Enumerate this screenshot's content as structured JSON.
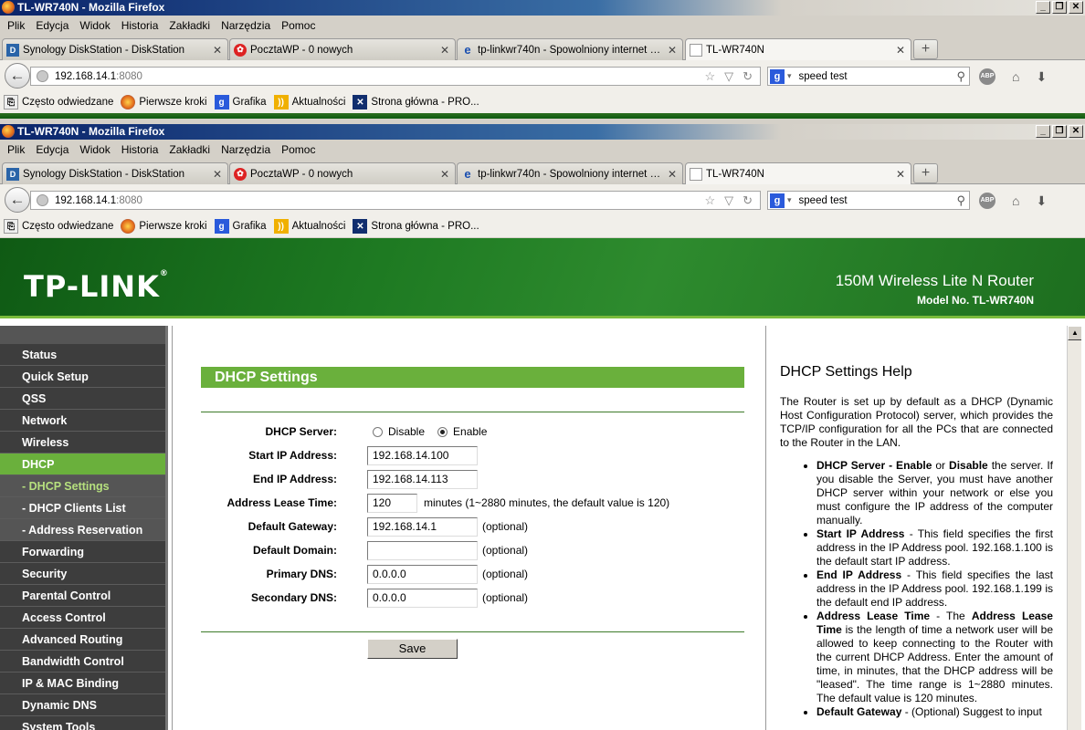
{
  "colors": {
    "brand_green": "#6ab03c",
    "banner_dark": "#0f5a14",
    "sidebar_bg": "#3d3d3d"
  },
  "window1": {
    "title": "TL-WR740N - Mozilla Firefox",
    "menu": [
      "Plik",
      "Edycja",
      "Widok",
      "Historia",
      "Zakładki",
      "Narzędzia",
      "Pomoc"
    ],
    "tabs": [
      {
        "icon": "diskstation-icon",
        "label": "Synology DiskStation - DiskStation"
      },
      {
        "icon": "poczta-icon",
        "label": "PocztaWP - 0 nowych"
      },
      {
        "icon": "ie-icon",
        "label": "tp-linkwr740n - Spowolniony internet od ..."
      },
      {
        "icon": "blank-page-icon",
        "label": "TL-WR740N"
      }
    ],
    "url_host": "192.168.14.1",
    "url_port": ":8080",
    "search_value": "speed test",
    "bookmarks": [
      "Często odwiedzane",
      "Pierwsze kroki",
      "Grafika",
      "Aktualności",
      "Strona główna - PRO..."
    ]
  },
  "window2": {
    "title": "TL-WR740N - Mozilla Firefox",
    "menu": [
      "Plik",
      "Edycja",
      "Widok",
      "Historia",
      "Zakładki",
      "Narzędzia",
      "Pomoc"
    ],
    "tabs": [
      {
        "icon": "diskstation-icon",
        "label": "Synology DiskStation - DiskStation"
      },
      {
        "icon": "poczta-icon",
        "label": "PocztaWP - 0 nowych"
      },
      {
        "icon": "ie-icon",
        "label": "tp-linkwr740n - Spowolniony internet od ..."
      },
      {
        "icon": "blank-page-icon",
        "label": "TL-WR740N"
      }
    ],
    "url_host": "192.168.14.1",
    "url_port": ":8080",
    "search_value": "speed test",
    "bookmarks": [
      "Często odwiedzane",
      "Pierwsze kroki",
      "Grafika",
      "Aktualności",
      "Strona główna - PRO..."
    ]
  },
  "router": {
    "logo": "TP-LINK",
    "product": "150M Wireless Lite N Router",
    "model": "Model No. TL-WR740N",
    "menu": [
      {
        "label": "Status",
        "type": "item"
      },
      {
        "label": "Quick Setup",
        "type": "item"
      },
      {
        "label": "QSS",
        "type": "item"
      },
      {
        "label": "Network",
        "type": "item"
      },
      {
        "label": "Wireless",
        "type": "item"
      },
      {
        "label": "DHCP",
        "type": "item",
        "active": true
      },
      {
        "label": "- DHCP Settings",
        "type": "sub",
        "active": true
      },
      {
        "label": "- DHCP Clients List",
        "type": "sub"
      },
      {
        "label": "- Address Reservation",
        "type": "sub"
      },
      {
        "label": "Forwarding",
        "type": "item"
      },
      {
        "label": "Security",
        "type": "item"
      },
      {
        "label": "Parental Control",
        "type": "item"
      },
      {
        "label": "Access Control",
        "type": "item"
      },
      {
        "label": "Advanced Routing",
        "type": "item"
      },
      {
        "label": "Bandwidth Control",
        "type": "item"
      },
      {
        "label": "IP & MAC Binding",
        "type": "item"
      },
      {
        "label": "Dynamic DNS",
        "type": "item"
      },
      {
        "label": "System Tools",
        "type": "item"
      }
    ],
    "form": {
      "heading": "DHCP Settings",
      "dhcp_server_label": "DHCP Server:",
      "disable_label": "Disable",
      "enable_label": "Enable",
      "selected": "Enable",
      "start_ip_label": "Start IP Address:",
      "start_ip": "192.168.14.100",
      "end_ip_label": "End IP Address:",
      "end_ip": "192.168.14.113",
      "lease_label": "Address Lease Time:",
      "lease": "120",
      "lease_note": "minutes (1~2880 minutes, the default value is 120)",
      "gateway_label": "Default Gateway:",
      "gateway": "192.168.14.1",
      "domain_label": "Default Domain:",
      "domain": "",
      "primary_dns_label": "Primary DNS:",
      "primary_dns": "0.0.0.0",
      "secondary_dns_label": "Secondary DNS:",
      "secondary_dns": "0.0.0.0",
      "optional": "(optional)",
      "save": "Save"
    },
    "help": {
      "title": "DHCP Settings Help",
      "intro": "The Router is set up by default as a DHCP (Dynamic Host Configuration Protocol) server, which provides the TCP/IP configuration for all the PCs that are connected to the Router in the LAN.",
      "items": [
        {
          "b1": "DHCP Server - Enable",
          "t1": " or ",
          "b2": "Disable",
          "t2": " the server. If you disable the Server, you must have another DHCP server within your network or else you must configure the IP address of the computer manually."
        },
        {
          "b1": "Start IP Address",
          "t1": " - This field specifies the first address in the IP Address pool. 192.168.1.100 is the default start IP address.",
          "b2": "",
          "t2": ""
        },
        {
          "b1": "End IP Address",
          "t1": " - This field specifies the last address in the IP Address pool. 192.168.1.199 is the default end IP address.",
          "b2": "",
          "t2": ""
        },
        {
          "b1": "Address Lease Time",
          "t1": " - The ",
          "b2": "Address Lease Time",
          "t2": " is the length of time a network user will be allowed to keep connecting to the Router with the current DHCP Address. Enter the amount of time, in minutes, that the DHCP address will be \"leased\". The time range is 1~2880 minutes. The default value is 120 minutes."
        },
        {
          "b1": "Default Gateway",
          "t1": " - (Optional) Suggest to input",
          "b2": "",
          "t2": ""
        }
      ]
    }
  }
}
